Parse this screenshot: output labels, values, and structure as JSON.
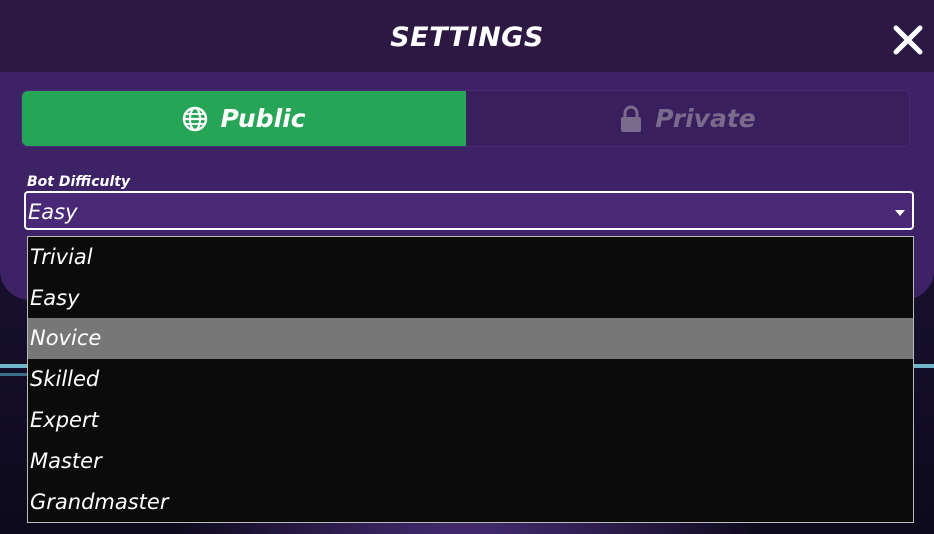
{
  "modal": {
    "title": "SETTINGS",
    "close_icon": "close-icon"
  },
  "tabs": [
    {
      "label": "Public",
      "icon": "globe-icon",
      "selected": true
    },
    {
      "label": "Private",
      "icon": "lock-icon",
      "selected": false
    }
  ],
  "bot_difficulty": {
    "label": "Bot Difficulty",
    "selected_value": "Easy",
    "highlighted_option": "Novice",
    "options": [
      "Trivial",
      "Easy",
      "Novice",
      "Skilled",
      "Expert",
      "Master",
      "Grandmaster"
    ]
  },
  "colors": {
    "modal_bg": "#3d2266",
    "header_bg": "#2d1844",
    "public_tab": "#26a556",
    "dropdown_bg": "#0b0b0b",
    "highlight": "#777777"
  }
}
